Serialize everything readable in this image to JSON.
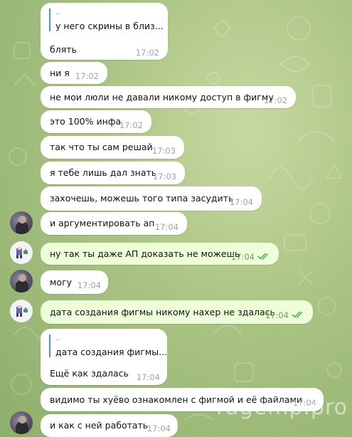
{
  "messages": [
    {
      "id": "m1",
      "reply": {
        "name": "..",
        "text": "у него скрины в близ..."
      },
      "text": "блять",
      "time": "17:02"
    },
    {
      "id": "m2",
      "text": "ни я",
      "time": "17:02"
    },
    {
      "id": "m3",
      "text": "не мои люли не давали никому доступ в фигму",
      "time": "17:02"
    },
    {
      "id": "m4",
      "text": "это 100% инфа",
      "time": "17:02"
    },
    {
      "id": "m5",
      "text": "так что ты сам решай",
      "time": "17:03"
    },
    {
      "id": "m6",
      "text": "я тебе лишь дал знать",
      "time": "17:03"
    },
    {
      "id": "m7",
      "text": "захочешь, можешь того типа засудить",
      "time": "17:04"
    },
    {
      "id": "m8",
      "text": "и аргументировать ап",
      "time": "17:04"
    },
    {
      "id": "m9",
      "text": "ну так ты даже АП доказать не можешь",
      "time": "17:04",
      "outgoing": true
    },
    {
      "id": "m10",
      "text": "могу",
      "time": "17:04"
    },
    {
      "id": "m11",
      "text": "дата создания фигмы никому нахер не здалась",
      "time": "17:04",
      "outgoing": true
    },
    {
      "id": "m12",
      "reply": {
        "name": "..",
        "text": "дата создания фигмы..."
      },
      "text": "Ещё как здалась",
      "time": "17:04"
    },
    {
      "id": "m13",
      "text": "видимо ты хуёво ознакомлен с фигмой и её файлами",
      "time": "17:04"
    },
    {
      "id": "m14",
      "text": "и как с ней работать",
      "time": "17:04"
    }
  ],
  "watermark": "ragemp.pro",
  "colors": {
    "incoming": "#ffffff",
    "outgoing": "#eefed9",
    "read_check": "#4fae4e",
    "reply_accent": "#4a90d9"
  },
  "icons": {
    "read": "double-check-icon"
  }
}
